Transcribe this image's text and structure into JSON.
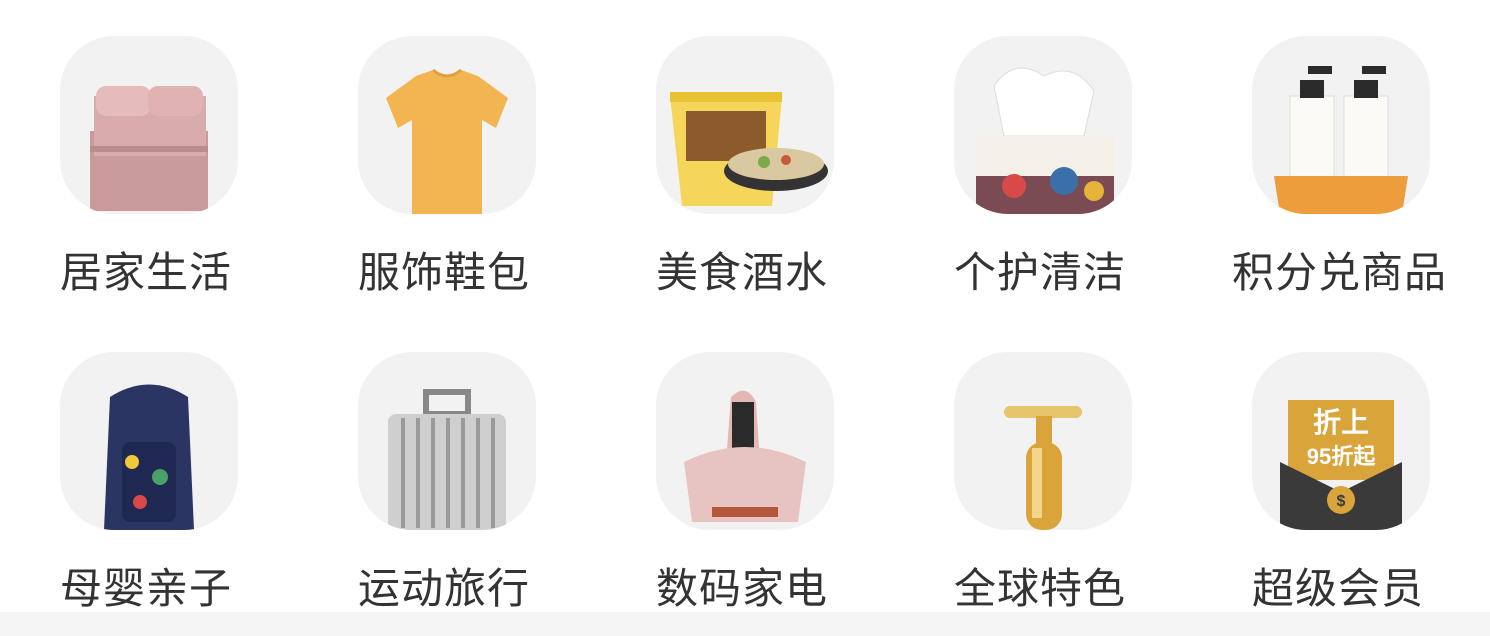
{
  "categories": [
    {
      "label": "居家生活",
      "icon": "bedding-icon"
    },
    {
      "label": "服饰鞋包",
      "icon": "tshirt-icon"
    },
    {
      "label": "美食酒水",
      "icon": "noodle-bowl-icon"
    },
    {
      "label": "个护清洁",
      "icon": "tissue-box-icon"
    },
    {
      "label": "积分兑商品",
      "icon": "lotion-bottles-icon"
    },
    {
      "label": "母婴亲子",
      "icon": "backpack-icon"
    },
    {
      "label": "运动旅行",
      "icon": "suitcase-icon"
    },
    {
      "label": "数码家电",
      "icon": "mite-vacuum-icon"
    },
    {
      "label": "全球特色",
      "icon": "beauty-bar-icon"
    },
    {
      "label": "超级会员",
      "icon": "member-envelope-icon"
    }
  ],
  "member_badge": {
    "line1": "折上",
    "line2": "95折起"
  },
  "colors": {
    "tile_bg": "#f2f2f2",
    "label": "#333333",
    "gold": "#d9a43a"
  }
}
